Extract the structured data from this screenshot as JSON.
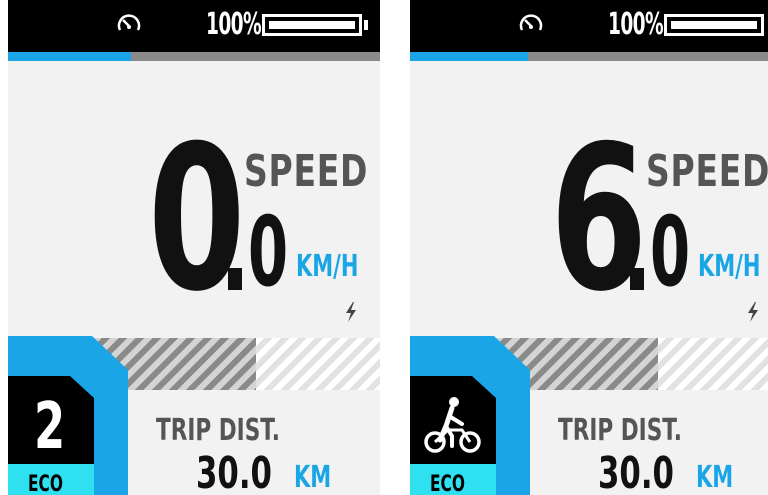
{
  "colors": {
    "accent": "#1aa6e6",
    "teal": "#2ee0f0",
    "background": "#f2f2f2",
    "bar": "#000000"
  },
  "screens": [
    {
      "status": {
        "battery_percent": "100%",
        "battery_level": 1.0,
        "speedometer_icon": "speedometer-icon"
      },
      "trip_progress": 0.33,
      "speed": {
        "integer": "0",
        "decimal": "0",
        "label": "SPEED",
        "unit": "KM/H"
      },
      "charging_icon": "bolt-icon",
      "assist": {
        "level": "2",
        "mode": "ECO"
      },
      "trip": {
        "label": "TRIP DIST.",
        "value": "30.0",
        "unit": "KM"
      }
    },
    {
      "status": {
        "battery_percent": "100%",
        "battery_level": 1.0,
        "speedometer_icon": "speedometer-icon"
      },
      "trip_progress": 0.33,
      "speed": {
        "integer": "6",
        "decimal": "0",
        "label": "SPEED",
        "unit": "KM/H"
      },
      "charging_icon": "bolt-icon",
      "assist": {
        "icon": "walk-assist-icon",
        "mode": "ECO"
      },
      "trip": {
        "label": "TRIP DIST.",
        "value": "30.0",
        "unit": "KM"
      }
    }
  ]
}
